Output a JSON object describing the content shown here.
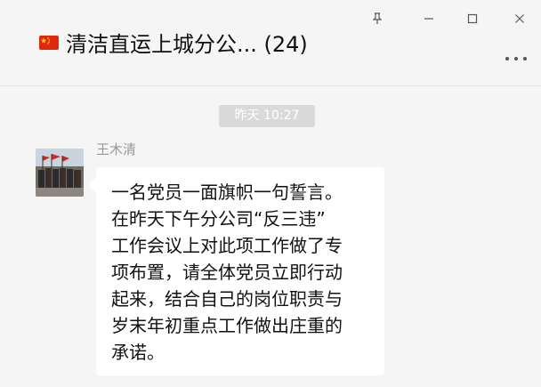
{
  "header": {
    "title": "清洁直运上城分公... (24)",
    "flag_icon": "china-flag-icon",
    "window_controls": [
      "pin-icon",
      "minimize-icon",
      "maximize-icon",
      "close-icon"
    ],
    "more_icon": "more-dots-icon"
  },
  "chat": {
    "timestamp": "昨天 10:27",
    "message": {
      "sender": "王木清",
      "avatar_icon": "group-photo-avatar",
      "text": "一名党员一面旗帜一句誓言。\n在昨天下午分公司“反三违”\n工作会议上对此项工作做了专\n项布置，请全体党员立即行动\n起来，结合自己的岗位职责与\n岁末年初重点工作做出庄重的\n承诺。"
    }
  },
  "colors": {
    "background": "#f5f5f5",
    "bubble": "#ffffff",
    "timestamp_bg": "#dadada",
    "sender_text": "#999999"
  }
}
